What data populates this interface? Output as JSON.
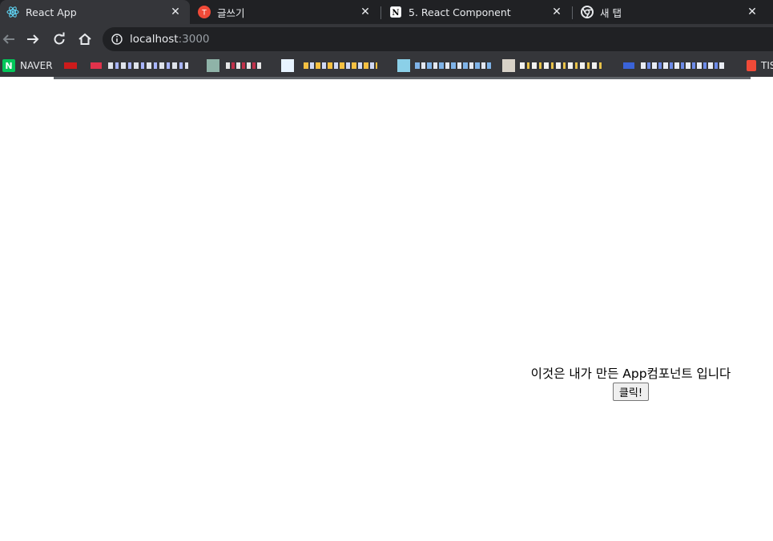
{
  "tabs": [
    {
      "title": "React App",
      "icon": "react-icon",
      "active": true
    },
    {
      "title": "글쓰기",
      "icon": "tistory-icon",
      "active": false
    },
    {
      "title": "5. React Component",
      "icon": "notion-icon",
      "active": false
    },
    {
      "title": "새 탭",
      "icon": "chrome-icon",
      "active": false
    }
  ],
  "address_bar": {
    "host": "localhost",
    "port": ":3000"
  },
  "bookmarks": {
    "naver_label": "NAVER",
    "last_label": "TIS"
  },
  "app": {
    "text": "이것은 내가 만든 App컴포넌트 입니다",
    "button_label": "클릭!"
  },
  "colors": {
    "tab_strip": "#202124",
    "toolbar": "#35363a",
    "omnibox": "#202124",
    "naver_green": "#03c75a",
    "tistory_red": "#f04a38"
  }
}
